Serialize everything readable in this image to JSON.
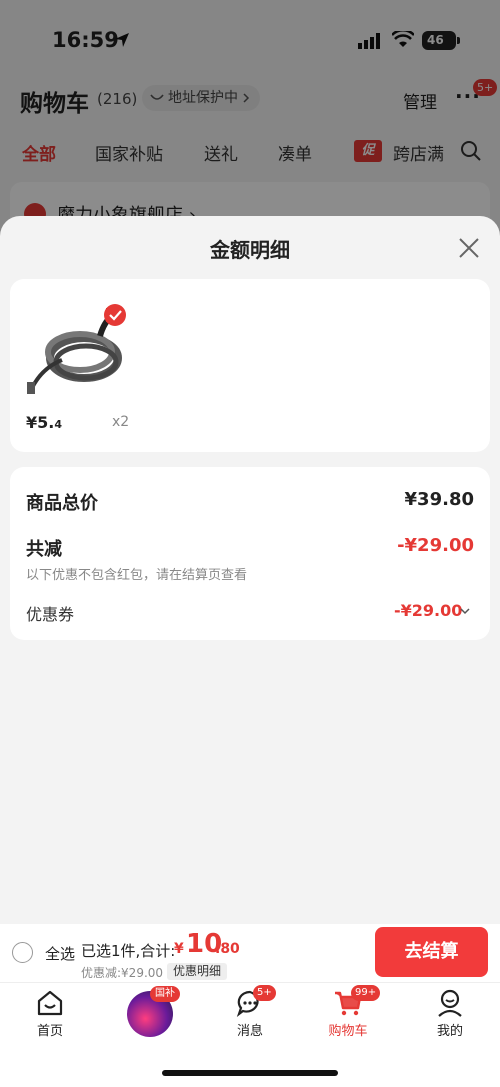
{
  "status_bar": {
    "time": "16:59",
    "battery": "46"
  },
  "header": {
    "title": "购物车",
    "count": "(216)",
    "address_protect": "地址保护中",
    "manage": "管理",
    "more_badge": "5+"
  },
  "tabs": [
    {
      "label": "全部",
      "active": true
    },
    {
      "label": "国家补贴"
    },
    {
      "label": "送礼"
    },
    {
      "label": "凑单"
    },
    {
      "label": "跨店满"
    }
  ],
  "promo_tag": "促",
  "store": {
    "name": "魔力小象旗舰店 ›"
  },
  "sheet": {
    "title": "金额明细",
    "product": {
      "price_int": "¥5.",
      "price_dec": "4",
      "qty": "x2"
    },
    "summary": {
      "goods_total_label": "商品总价",
      "goods_total_value": "¥39.80",
      "reduce_label": "共减",
      "reduce_value": "-¥29.00",
      "note": "以下优惠不包含红包，请在结算页查看",
      "coupon_label": "优惠券",
      "coupon_value": "-¥29.00"
    }
  },
  "checkout": {
    "select_all": "全选",
    "selected_text": "已选1件,合计:",
    "currency": "¥",
    "total_int": "10",
    "total_dec": ".80",
    "discount_text": "优惠减:¥29.00",
    "detail_tag": "优惠明细",
    "button": "去结算"
  },
  "nav": {
    "home": "首页",
    "guobu_badge": "国补",
    "messages": "消息",
    "messages_badge": "5+",
    "cart": "购物车",
    "cart_badge": "99+",
    "mine": "我的"
  },
  "colors": {
    "accent": "#e53935",
    "button": "#f23b3b"
  }
}
